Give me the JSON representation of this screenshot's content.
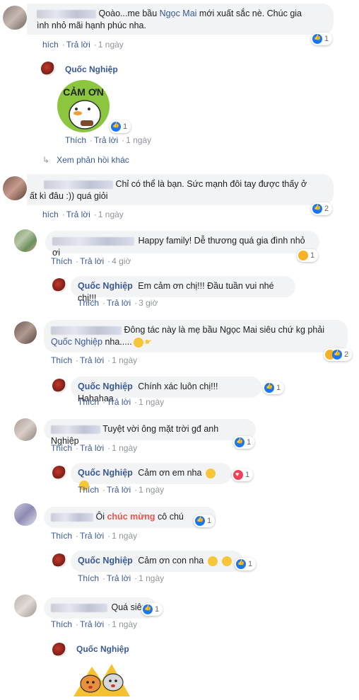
{
  "comments": {
    "c1": {
      "text_a": "Qoào...me bầu ",
      "highlight": "Ngọc Mai",
      "text_b": " mới xuất sắc nè. Chúc gia",
      "line2": "ình nhỏ mãi hạnh phúc nha.",
      "reactions": "1",
      "like": "hích",
      "reply": "Trả lời",
      "time": "1 ngày"
    },
    "r1": {
      "author": "Quốc Nghiệp",
      "sticker_text": "CẢM ƠN",
      "reactions": "1",
      "like": "Thích",
      "reply": "Trả lời",
      "time": "1 ngày"
    },
    "more_replies": "Xem phản hồi khác",
    "c2": {
      "text": "Chỉ có thể là bạn. Sức mạnh đôi tay được thấy ở",
      "line2": "ất kì đâu :)) quá giỏi",
      "reactions": "2",
      "like": "hích",
      "reply": "Trả lời",
      "time": "1 ngày"
    },
    "c3": {
      "text": "Happy family! Dễ thương quá gia đình nhỏ ơi",
      "reactions": "1",
      "like": "Thích",
      "reply": "Trả lời",
      "time": "4 giờ"
    },
    "r3": {
      "author": "Quốc Nghiệp",
      "text": "Em cảm ơn chị!!! Đầu tuần vui nhé chị!!!",
      "like": "Thích",
      "reply": "Trả lời",
      "time": "3 giờ"
    },
    "c4": {
      "text": "Đông tác này là mẹ bầu Ngọc Mai siêu chứ kg phải",
      "mention": "Quốc Nghiệp",
      "text_b": " nha.....",
      "reactions": "2",
      "like": "Thích",
      "reply": "Trả lời",
      "time": "1 ngày"
    },
    "r4": {
      "author": "Quốc Nghiệp",
      "text": "Chính xác luôn chị!!! Hahahaa",
      "reactions": "1",
      "like": "Thích",
      "reply": "Trả lời",
      "time": "1 ngày"
    },
    "c5": {
      "text": "Tuyệt vời ông mặt trời gđ anh Nghiệp",
      "reactions": "1",
      "like": "Thích",
      "reply": "Trả lời",
      "time": "1 ngày"
    },
    "r5": {
      "author": "Quốc Nghiệp",
      "text": "Cảm ơn em nha",
      "reactions": "1",
      "like": "Thích",
      "reply": "Trả lời",
      "time": "1 ngày"
    },
    "c6": {
      "text_a": "Ôi ",
      "highlight": "chúc mừng",
      "text_b": " cô chú",
      "reactions": "1",
      "like": "Thích",
      "reply": "Trả lời",
      "time": "1 ngày"
    },
    "r6": {
      "author": "Quốc Nghiệp",
      "text": "Cảm ơn con nha",
      "reactions": "1",
      "like": "Thích",
      "reply": "Trả lời",
      "time": "1 ngày"
    },
    "c7": {
      "text": "Quá siêu!",
      "reactions": "1",
      "like": "Thích",
      "reply": "Trả lời",
      "time": "1 ngày"
    },
    "r7": {
      "author": "Quốc Nghiệp"
    }
  },
  "colors": {
    "link": "#385898",
    "bubble": "#f2f3f5",
    "like": "#1877f2",
    "highlight_red": "#e9554d"
  }
}
